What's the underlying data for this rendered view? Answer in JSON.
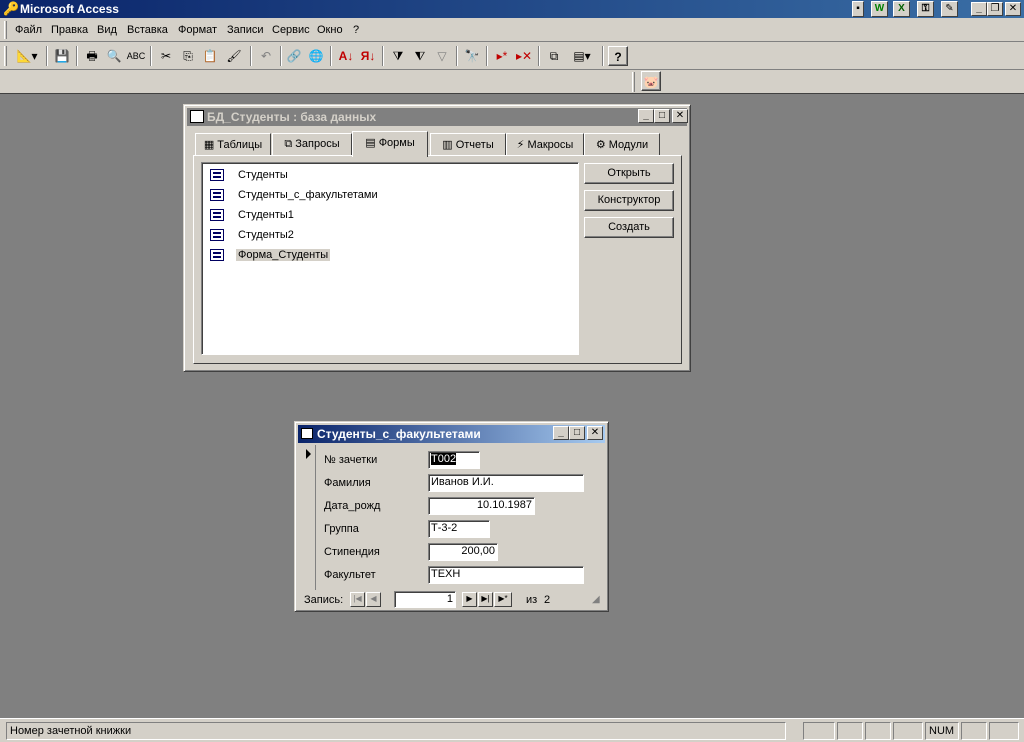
{
  "app": {
    "title": "Microsoft Access",
    "office_buttons": [
      "W",
      "X"
    ]
  },
  "menu": {
    "items": [
      {
        "label": "Файл",
        "left": 0
      },
      {
        "label": "Правка"
      },
      {
        "label": "Вид"
      },
      {
        "label": "Вставка"
      },
      {
        "label": "Формат"
      },
      {
        "label": "Записи"
      },
      {
        "label": "Сервис"
      },
      {
        "label": "Окно"
      },
      {
        "label": "?"
      }
    ]
  },
  "toolbar": {
    "buttons": [
      "view-icon",
      "save-icon",
      "print-icon",
      "preview-icon",
      "spelling-icon",
      "cut-icon",
      "copy-icon",
      "paste-icon",
      "format-painter-icon",
      "undo-icon",
      "hyperlink-icon",
      "web-icon",
      "sort-ascending-icon",
      "sort-descending-icon",
      "filter-selection-icon",
      "filter-form-icon",
      "apply-filter-icon",
      "find-icon",
      "new-record-icon",
      "delete-record-icon",
      "database-window-icon",
      "new-object-icon",
      "help-icon"
    ]
  },
  "db_window": {
    "title": "БД_Студенты : база данных",
    "tabs": [
      "Таблицы",
      "Запросы",
      "Формы",
      "Отчеты",
      "Макросы",
      "Модули"
    ],
    "active_tab": "Формы",
    "forms": [
      "Студенты",
      "Студенты_с_факультетами",
      "Студенты1",
      "Студенты2",
      "Форма_Студенты"
    ],
    "selected_form": "Форма_Студенты",
    "buttons": {
      "open": "Открыть",
      "design": "Конструктор",
      "create": "Создать"
    }
  },
  "form_window": {
    "title": "Студенты_с_факультетами",
    "fields": {
      "gradebook_label": "№ зачетки",
      "gradebook_value": "T002",
      "surname_label": "Фамилия",
      "surname_value": "Иванов И.И.",
      "birthdate_label": "Дата_рожд",
      "birthdate_value": "10.10.1987",
      "group_label": "Группа",
      "group_value": "Т-3-2",
      "stipend_label": "Стипендия",
      "stipend_value": "200,00",
      "faculty_label": "Факультет",
      "faculty_value": "ТЕХН"
    },
    "nav": {
      "record_label": "Запись:",
      "current": "1",
      "of_label": "из",
      "total": "2"
    }
  },
  "status": {
    "text": "Номер зачетной книжки",
    "num": "NUM"
  },
  "colors": {
    "active_title": "#0a246a",
    "inactive_title": "#808080",
    "face": "#d4d0c8",
    "workspace": "#808080"
  }
}
